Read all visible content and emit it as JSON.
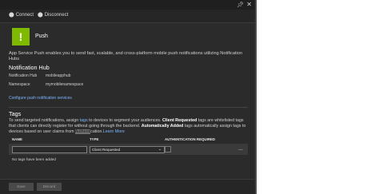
{
  "commands": {
    "connect": "Connect",
    "disconnect": "Disconnect"
  },
  "header": {
    "title": "Push"
  },
  "description": "App Service Push enables you to send fast, scalable, and cross-platform mobile push notifications utilizing Notification Hubs",
  "notification_hub": {
    "title": "Notification Hub",
    "hub_label": "Notification Hub",
    "hub_value": "mobileapphub",
    "namespace_label": "Namespace",
    "namespace_value": "mymobilenamespace",
    "configure_link": "Configure push notification services"
  },
  "tags": {
    "title": "Tags",
    "desc_part1": "To send targeted notifications, assign ",
    "desc_tags_link": "tags",
    "desc_part2": " to devices to segment your audiences. ",
    "desc_client_requested": "Client Requested",
    "desc_part3": " tags are whitelisted tags that clients can directly register for without going through the backend. ",
    "desc_auto_added": "Automatically Added",
    "desc_part4": " tags automatically assign tags to devices based on user claims from ",
    "desc_highlight": "Authenti",
    "desc_part5": "cation.",
    "desc_learn_more": "Learn More",
    "columns": {
      "name": "NAME",
      "type": "TYPE",
      "auth": "AUTHENTICATION REQUIRED"
    },
    "new_row": {
      "name_value": "",
      "type_value": "Client Requested",
      "more": "..."
    },
    "empty_text": "No tags have been added"
  },
  "footer": {
    "save": "Save",
    "discard": "Discard"
  }
}
